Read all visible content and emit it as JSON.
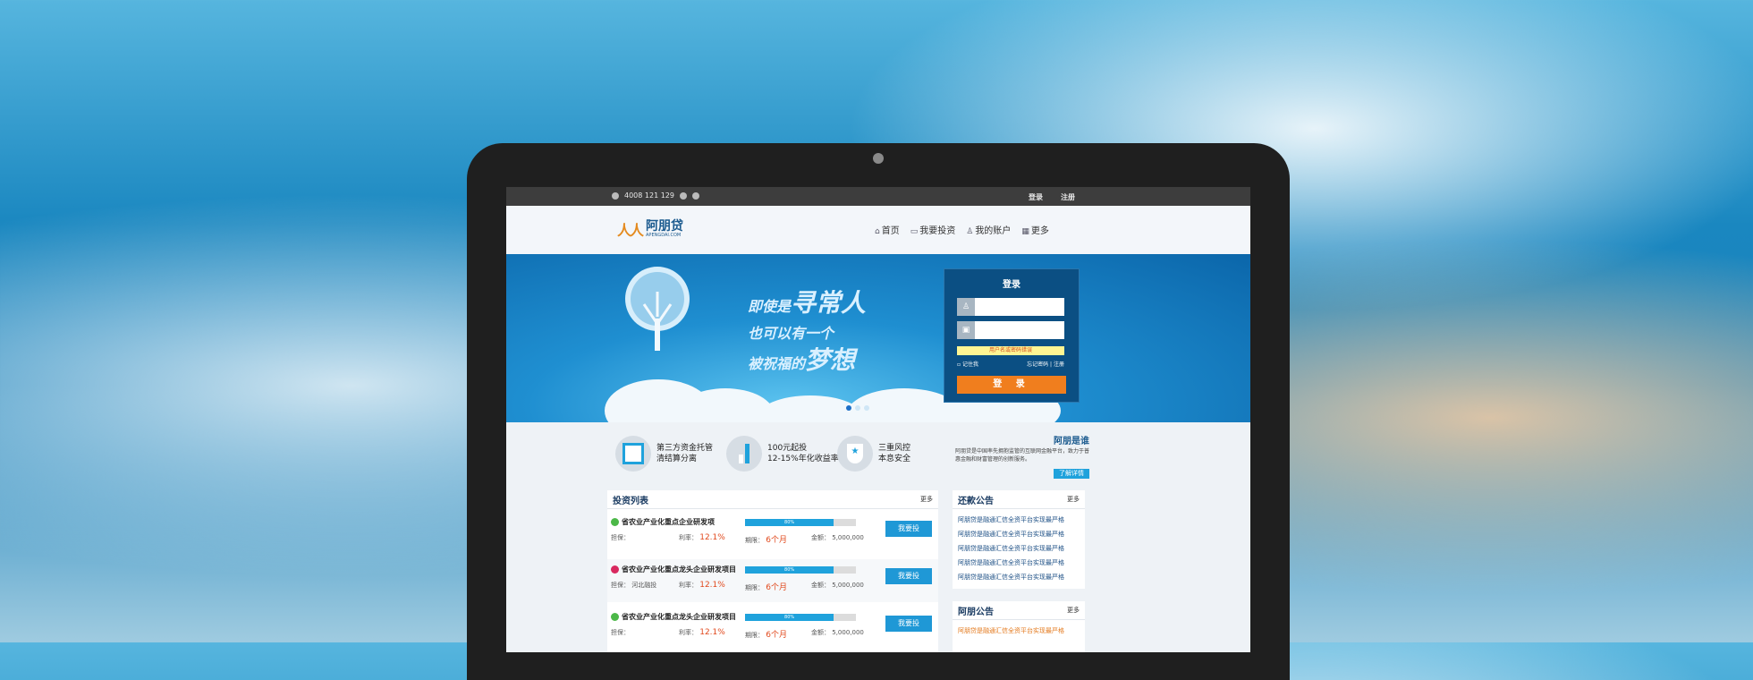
{
  "topbar": {
    "phone": "4008 121 129",
    "login": "登录",
    "register": "注册"
  },
  "logo": {
    "name": "阿朋贷",
    "domain": "APENGDAI.COM"
  },
  "nav": [
    {
      "icon": "home-icon",
      "glyph": "⌂",
      "label": "首页"
    },
    {
      "icon": "wallet-icon",
      "glyph": "▭",
      "label": "我要投资"
    },
    {
      "icon": "user-icon",
      "glyph": "♙",
      "label": "我的账户"
    },
    {
      "icon": "grid-icon",
      "glyph": "▦",
      "label": "更多"
    }
  ],
  "banner": {
    "line1": "即使是",
    "line1_big": "寻常人",
    "line2": "也可以有一个",
    "line3": "被祝福的",
    "line3_big": "梦想"
  },
  "login": {
    "title": "登录",
    "error": "用户名或密码错误",
    "remember": "记住我",
    "forgot": "忘记密码",
    "register": "注册",
    "submit": "登 录"
  },
  "features": [
    {
      "line1": "第三方资金托管",
      "line2": "清结算分离"
    },
    {
      "line1": "100元起投",
      "line2": "12-15%年化收益率"
    },
    {
      "line1": "三重风控",
      "line2": "本息安全"
    }
  ],
  "about": {
    "title": "阿朋是谁",
    "text": "阿朋贷是中国率先拥抱监管的互联网金融平台，致力于普惠金融和财富管理的创新服务。",
    "more": "了解详情"
  },
  "investments": {
    "title": "投资列表",
    "more": "更多",
    "labels": {
      "rate": "利率：",
      "term": "期限：",
      "amount": "金额：",
      "guarantee": "担保：",
      "button": "我要投"
    },
    "items": [
      {
        "name": "省农业产业化重点企业研发项",
        "badge_color": "#4cb848",
        "progress": "80%",
        "guarantor": "",
        "rate": "12.1%",
        "term": "6个月",
        "amount": "5,000,000"
      },
      {
        "name": "省农业产业化重点龙头企业研发项目",
        "badge_color": "#d9295f",
        "progress": "80%",
        "guarantor": "河北融投",
        "rate": "12.1%",
        "term": "6个月",
        "amount": "5,000,000"
      },
      {
        "name": "省农业产业化重点龙头企业研发项目",
        "badge_color": "#4cb848",
        "progress": "80%",
        "guarantor": "",
        "rate": "12.1%",
        "term": "6个月",
        "amount": "5,000,000"
      }
    ]
  },
  "repayment": {
    "title": "还款公告",
    "more": "更多",
    "items": [
      "阿朋贷是融通汇信全资平台实现最严格",
      "阿朋贷是融通汇信全资平台实现最严格",
      "阿朋贷是融通汇信全资平台实现最严格",
      "阿朋贷是融通汇信全资平台实现最严格",
      "阿朋贷是融通汇信全资平台实现最严格"
    ]
  },
  "news": {
    "title": "阿朋公告",
    "more": "更多",
    "items": [
      "阿朋贷是融通汇信全资平台实现最严格"
    ]
  }
}
